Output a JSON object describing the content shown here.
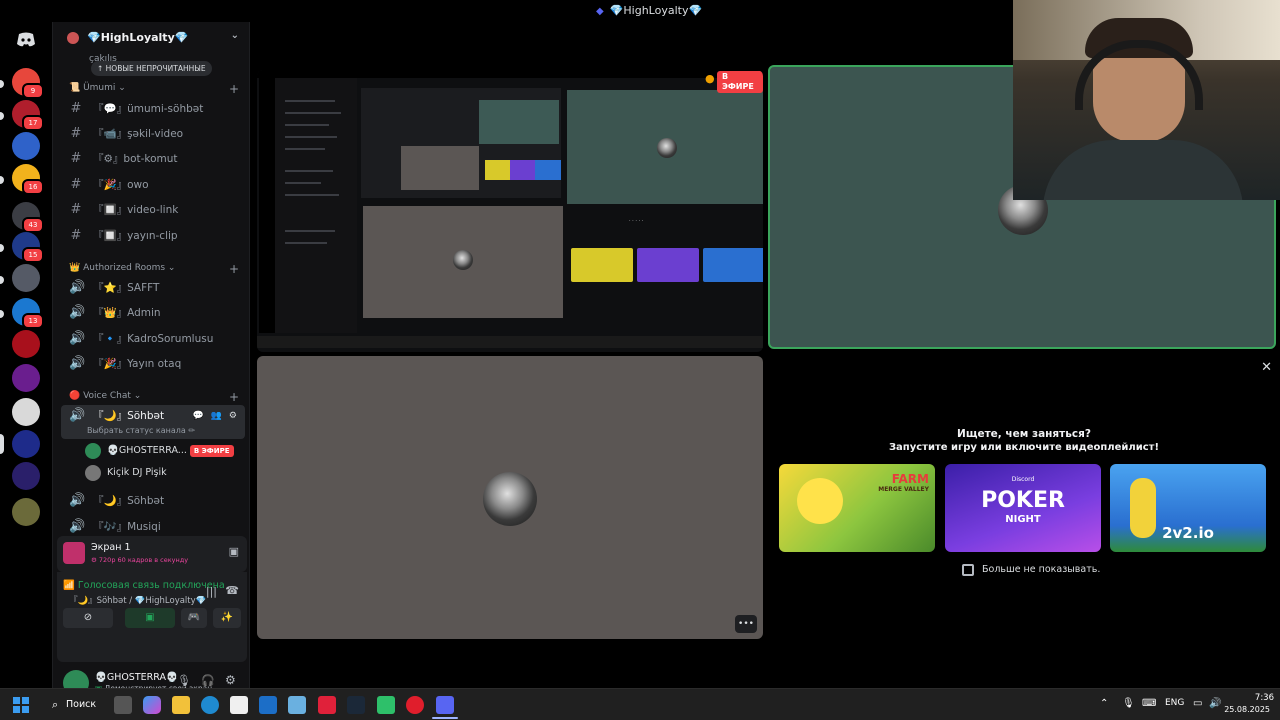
{
  "window": {
    "title": "💎HighLoyalty💎"
  },
  "rail": {
    "badges": [
      "9",
      "17",
      "16",
      "43",
      "15",
      "13"
    ]
  },
  "server": {
    "name": "💎HighLoyalty💎",
    "new_unread": "НОВЫЕ НЕПРОЧИТАННЫЕ",
    "partial_channel": "çakılış",
    "categories": [
      {
        "label": "Ümumi"
      },
      {
        "label": "Authorized Rooms"
      },
      {
        "label": "Voice Chat"
      }
    ],
    "text_channels": [
      {
        "label": "『💬』ümumi-söhbət"
      },
      {
        "label": "『📹』şəkil-video"
      },
      {
        "label": "『⚙』bot-komut"
      },
      {
        "label": "『🎉』owo"
      },
      {
        "label": "『🔲』video-link"
      },
      {
        "label": "『🔲』yayın-clip"
      }
    ],
    "authorized_rooms": [
      {
        "label": "『⭐』SAFFT"
      },
      {
        "label": "『👑』Admin"
      },
      {
        "label": "『🔹』KadroSorumlusu"
      },
      {
        "label": "『🎉』Yayın otaq"
      }
    ],
    "voice_active": {
      "label": "『🌙』Söhbət",
      "status": "Выбрать статус канала ✏"
    },
    "members": [
      {
        "name": "💀GHOSTERRA...",
        "badge": "В ЭФИРЕ"
      },
      {
        "name": "Kiçik DJ Pişik"
      }
    ],
    "voice_channels": [
      {
        "label": "『🌙』Söhbət"
      },
      {
        "label": "『🎶』Musiqi"
      }
    ]
  },
  "stream_panel": {
    "title": "Экран 1",
    "quality": "720p 60 кадров в секунду"
  },
  "voice_panel": {
    "status": "Голосовая связь подключена",
    "channel": "『🌙』Söhbət / 💎HighLoyalty💎"
  },
  "user_panel": {
    "name": "💀GHOSTERRA💀",
    "activity": "Демонстрирует свой экран"
  },
  "stage": {
    "live_label": "В ЭФИРЕ",
    "activity_prompt": {
      "line1": "Ищете, чем заняться?",
      "line2": "Запустите игру или включите видеоплейлист!",
      "checkbox": "Больше не показывать.",
      "cards": [
        {
          "name": "Farm Merge Valley",
          "logo": "FARM",
          "sub": "MERGE VALLEY"
        },
        {
          "name": "Poker Night",
          "logo": "POKER",
          "sub": "NIGHT",
          "top": "Discord"
        },
        {
          "name": "2v2.io",
          "logo": "2v2.io"
        }
      ],
      "close": "✕"
    },
    "more_button": "•••"
  },
  "taskbar": {
    "search_label": "Поиск",
    "lang": "ENG",
    "time": "7:36",
    "date": "25.08.2025"
  },
  "colors": {
    "accent": "#5865f2",
    "live": "#f23f43",
    "online": "#23a55a",
    "speaking": "#3ba55c"
  }
}
